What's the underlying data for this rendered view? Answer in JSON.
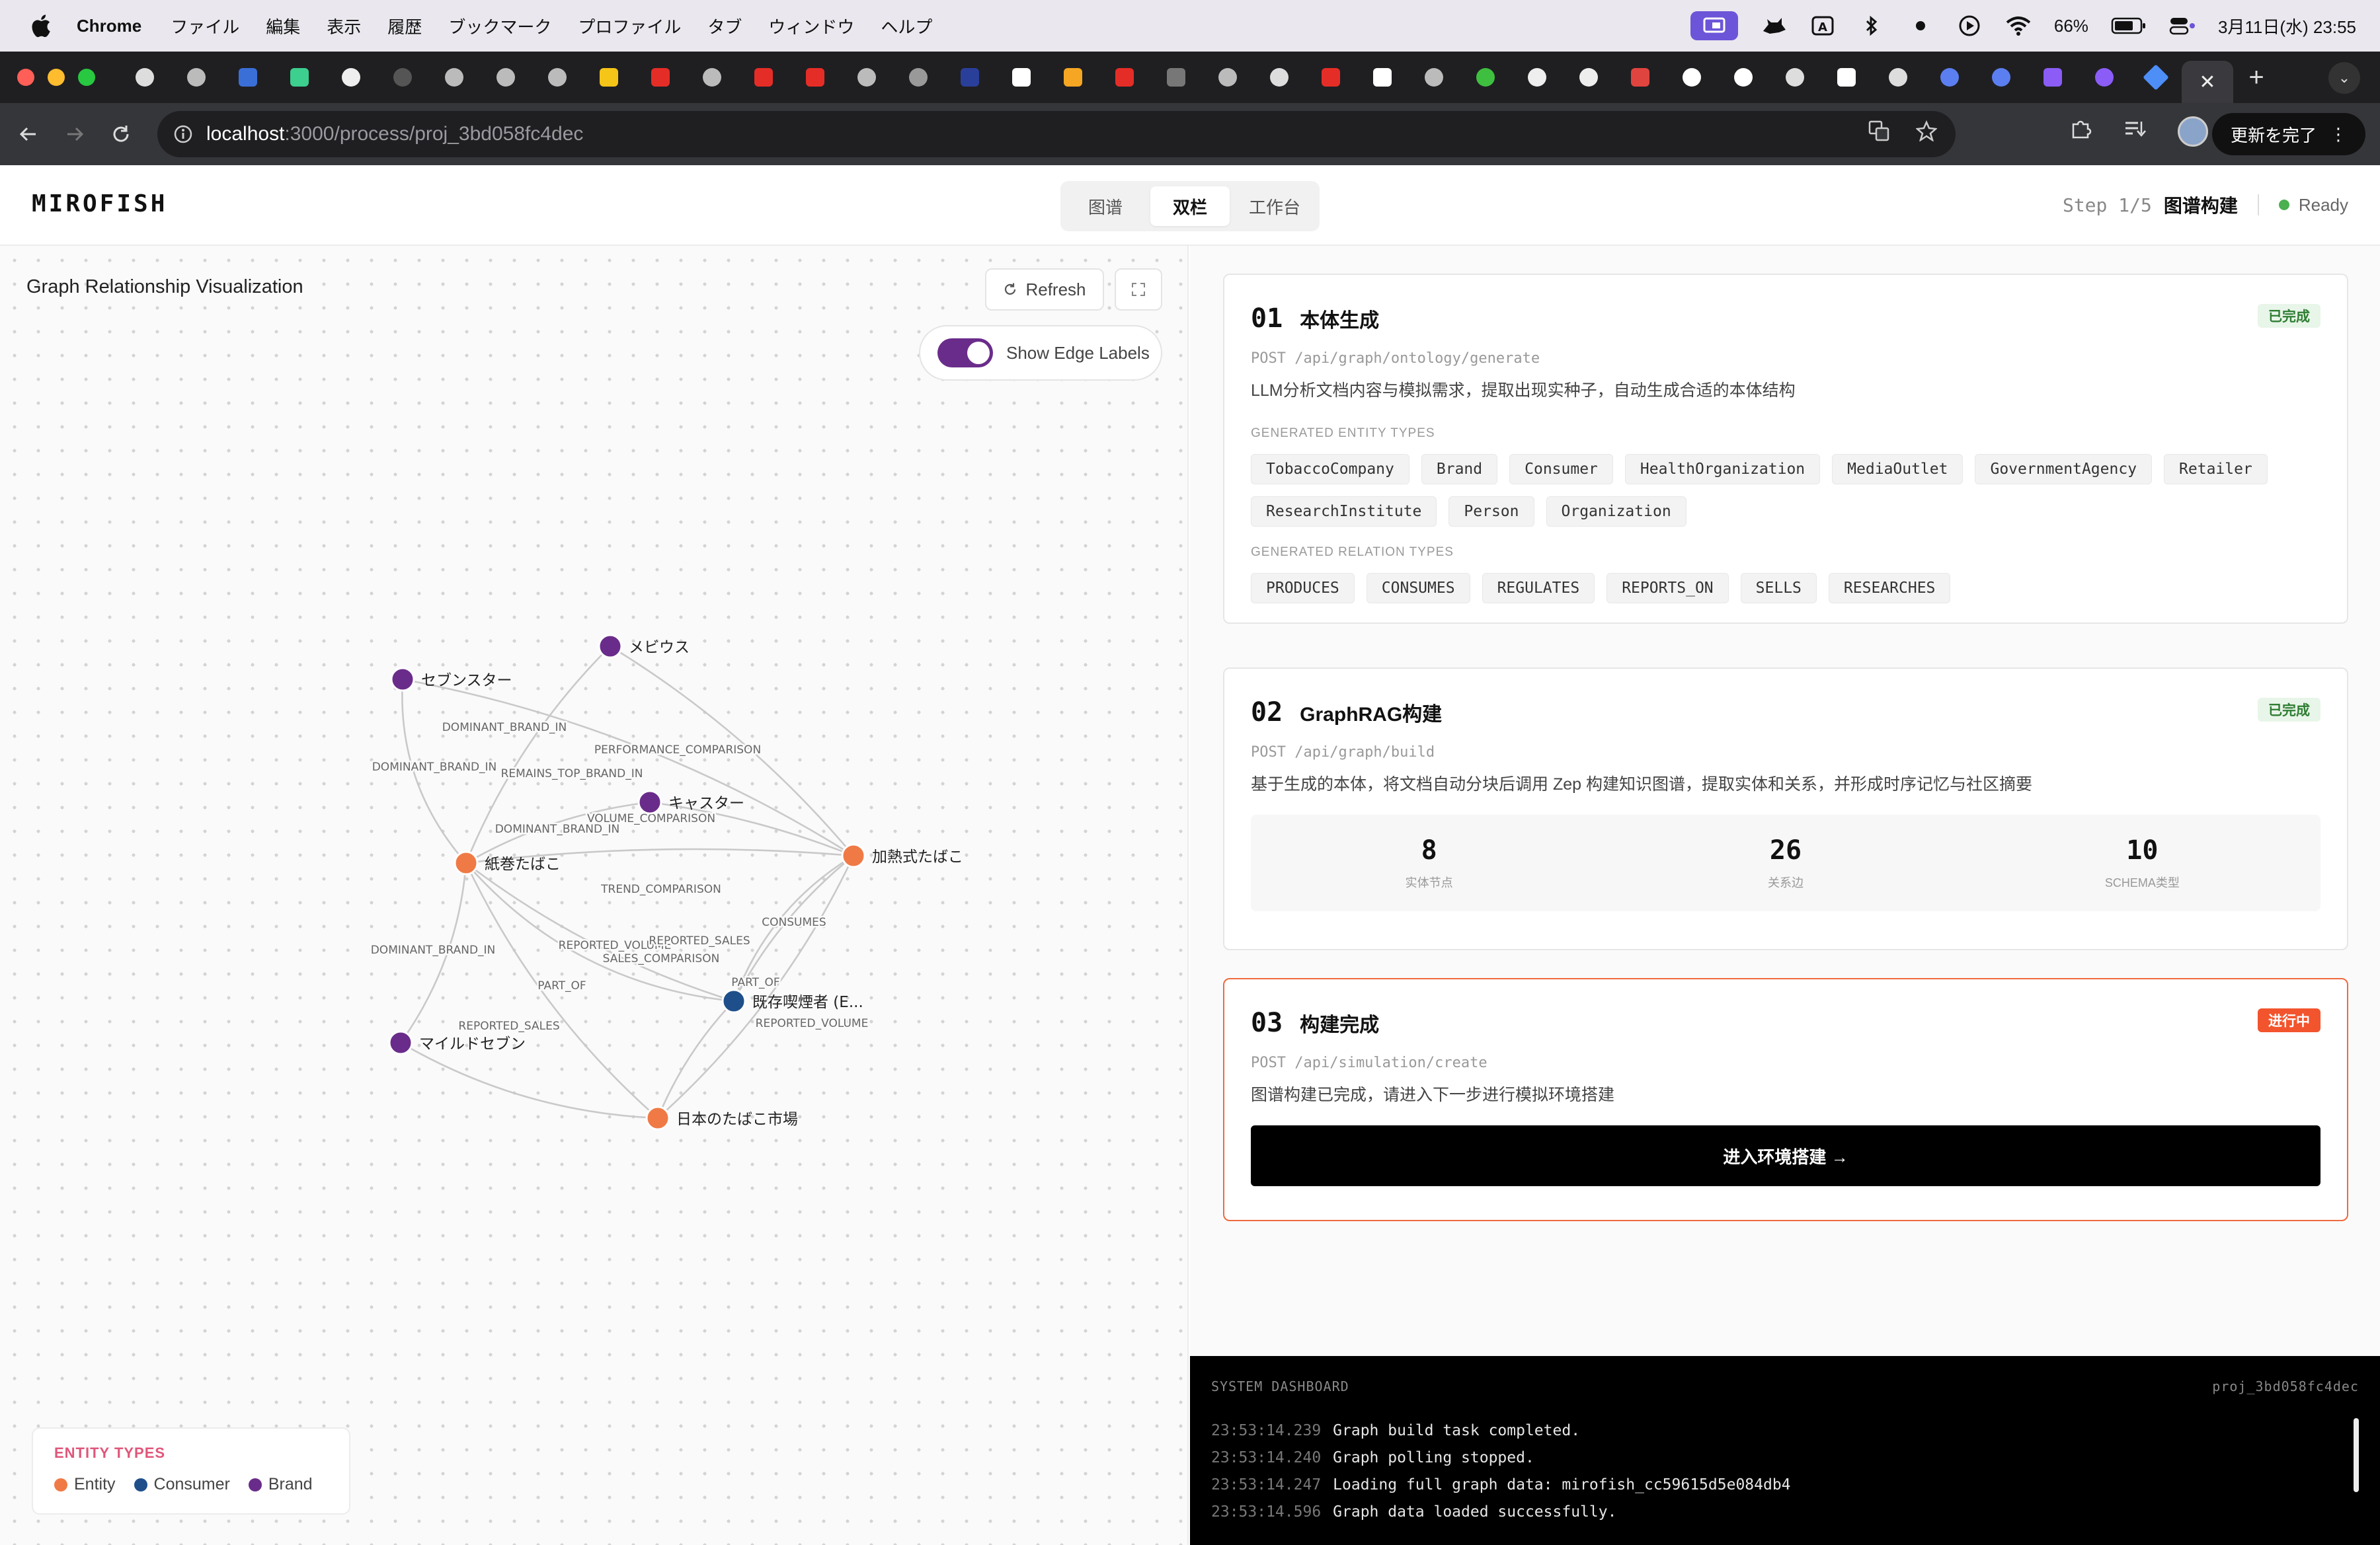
{
  "menubar": {
    "items": [
      "Chrome",
      "ファイル",
      "編集",
      "表示",
      "履歴",
      "ブックマーク",
      "プロファイル",
      "タブ",
      "ウィンドウ",
      "ヘルプ"
    ],
    "battery": "66%",
    "datetime": "3月11日(水)  23:55"
  },
  "browser": {
    "url_host": "localhost",
    "url_path": ":3000/process/proj_3bd058fc4dec",
    "update_label": "更新を完了"
  },
  "app": {
    "brand": "MIROFISH",
    "view_tabs": [
      "图谱",
      "双栏",
      "工作台"
    ],
    "active_view": "双栏",
    "step_num": "Step 1/5",
    "step_name": "图谱构建",
    "status": "Ready"
  },
  "graph": {
    "title": "Graph Relationship Visualization",
    "refresh_label": "Refresh",
    "toggle_label": "Show Edge Labels",
    "toggle_on": true,
    "colors": {
      "Entity": "#f07a45",
      "Consumer": "#1f4f8a",
      "Brand": "#6a2c8a",
      "edge": "#c9c9c9"
    },
    "nodes": [
      {
        "id": "n_mevius",
        "label": "メビウス",
        "type": "Brand"
      },
      {
        "id": "n_seven",
        "label": "セブンスター",
        "type": "Brand"
      },
      {
        "id": "n_caster",
        "label": "キャスター",
        "type": "Brand"
      },
      {
        "id": "n_paper",
        "label": "紙巻たばこ",
        "type": "Entity"
      },
      {
        "id": "n_heated",
        "label": "加熱式たばこ",
        "type": "Entity"
      },
      {
        "id": "n_smokers",
        "label": "既存喫煙者 (E...",
        "type": "Consumer"
      },
      {
        "id": "n_mild",
        "label": "マイルドセブン",
        "type": "Brand"
      },
      {
        "id": "n_market",
        "label": "日本のたばこ市場",
        "type": "Entity"
      }
    ],
    "edges": [
      {
        "source": "n_mevius",
        "target": "n_paper",
        "label": "DOMINANT_BRAND_IN"
      },
      {
        "source": "n_seven",
        "target": "n_paper",
        "label": "DOMINANT_BRAND_IN"
      },
      {
        "source": "n_mevius",
        "target": "n_heated",
        "label": "PERFORMANCE_COMPARISON"
      },
      {
        "source": "n_seven",
        "target": "n_heated",
        "label": "REMAINS_TOP_BRAND_IN"
      },
      {
        "source": "n_caster",
        "target": "n_paper",
        "label": "DOMINANT_BRAND_IN"
      },
      {
        "source": "n_caster",
        "target": "n_heated",
        "label": "VOLUME_COMPARISON"
      },
      {
        "source": "n_paper",
        "target": "n_heated",
        "label": "TREND_COMPARISON"
      },
      {
        "source": "n_mild",
        "target": "n_paper",
        "label": "DOMINANT_BRAND_IN"
      },
      {
        "source": "n_paper",
        "target": "n_smokers",
        "label": "REPORTED_VOLUME"
      },
      {
        "source": "n_paper",
        "target": "n_smokers",
        "label": "SALES_COMPARISON"
      },
      {
        "source": "n_smokers",
        "target": "n_heated",
        "label": "CONSUMES"
      },
      {
        "source": "n_heated",
        "target": "n_smokers",
        "label": "REPORTED_SALES"
      },
      {
        "source": "n_paper",
        "target": "n_market",
        "label": "PART_OF"
      },
      {
        "source": "n_smokers",
        "target": "n_market",
        "label": "PART_OF"
      },
      {
        "source": "n_mild",
        "target": "n_market",
        "label": "REPORTED_SALES"
      },
      {
        "source": "n_heated",
        "target": "n_market",
        "label": "REPORTED_VOLUME"
      }
    ],
    "legend_title": "ENTITY TYPES",
    "legend": [
      {
        "label": "Entity",
        "color": "#f07a45"
      },
      {
        "label": "Consumer",
        "color": "#1f4f8a"
      },
      {
        "label": "Brand",
        "color": "#6a2c8a"
      }
    ]
  },
  "steps": {
    "s1": {
      "num": "01",
      "title": "本体生成",
      "badge": "已完成",
      "api": "POST /api/graph/ontology/generate",
      "desc": "LLM分析文档内容与模拟需求，提取出现实种子，自动生成合适的本体结构",
      "entity_label": "GENERATED ENTITY TYPES",
      "entity_types": [
        "TobaccoCompany",
        "Brand",
        "Consumer",
        "HealthOrganization",
        "MediaOutlet",
        "GovernmentAgency",
        "Retailer",
        "ResearchInstitute",
        "Person",
        "Organization"
      ],
      "relation_label": "GENERATED RELATION TYPES",
      "relation_types": [
        "PRODUCES",
        "CONSUMES",
        "REGULATES",
        "REPORTS_ON",
        "SELLS",
        "RESEARCHES"
      ]
    },
    "s2": {
      "num": "02",
      "title": "GraphRAG构建",
      "badge": "已完成",
      "api": "POST /api/graph/build",
      "desc": "基于生成的本体，将文档自动分块后调用 Zep 构建知识图谱，提取实体和关系，并形成时序记忆与社区摘要",
      "stats": [
        {
          "value": "8",
          "label": "实体节点"
        },
        {
          "value": "26",
          "label": "关系边"
        },
        {
          "value": "10",
          "label": "SCHEMA类型"
        }
      ]
    },
    "s3": {
      "num": "03",
      "title": "构建完成",
      "badge": "进行中",
      "api": "POST /api/simulation/create",
      "desc": "图谱构建已完成，请进入下一步进行模拟环境搭建",
      "button": "进入环境搭建 →"
    }
  },
  "dashboard": {
    "title": "SYSTEM DASHBOARD",
    "project": "proj_3bd058fc4dec",
    "logs": [
      {
        "time": "23:53:14.239",
        "msg": "Graph build task completed."
      },
      {
        "time": "23:53:14.240",
        "msg": "Graph polling stopped."
      },
      {
        "time": "23:53:14.247",
        "msg": "Loading full graph data: mirofish_cc59615d5e084db4"
      },
      {
        "time": "23:53:14.596",
        "msg": "Graph data loaded successfully."
      }
    ]
  }
}
